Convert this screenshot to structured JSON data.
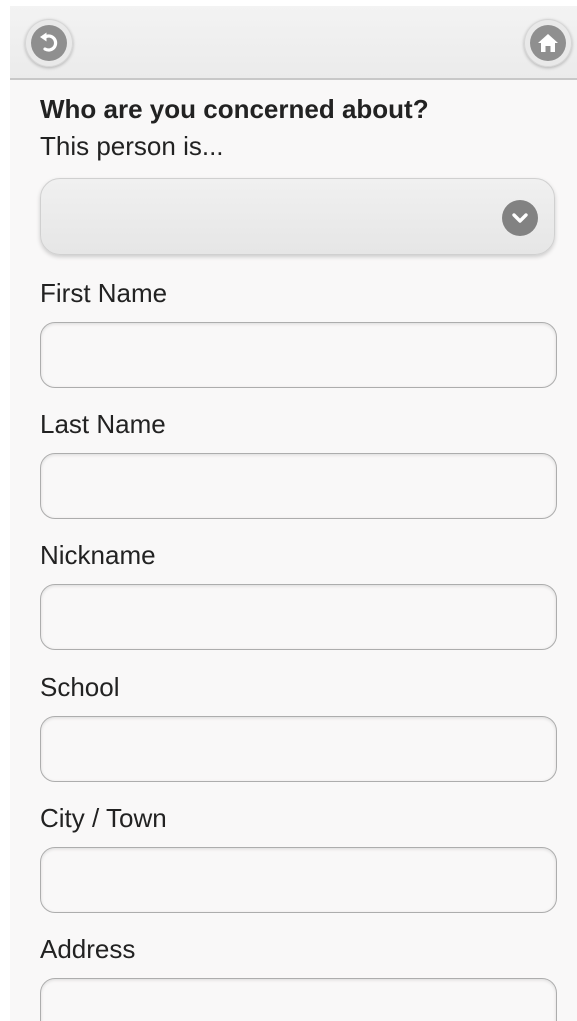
{
  "header": {
    "back_icon": "back-arrow-icon",
    "home_icon": "home-icon"
  },
  "form": {
    "heading": "Who are you concerned about?",
    "subheading": "This person is...",
    "relationship_select": {
      "selected": "",
      "icon": "chevron-down-icon"
    },
    "fields": {
      "first_name": {
        "label": "First Name",
        "value": ""
      },
      "last_name": {
        "label": "Last Name",
        "value": ""
      },
      "nickname": {
        "label": "Nickname",
        "value": ""
      },
      "school": {
        "label": "School",
        "value": ""
      },
      "city_town": {
        "label": "City / Town",
        "value": ""
      },
      "address": {
        "label": "Address",
        "value": ""
      }
    }
  },
  "colors": {
    "background": "#f9f8f8",
    "header": "#eeeeee",
    "icon_gray": "#8f8f8f",
    "text": "#222222",
    "input_border": "#adadad"
  }
}
